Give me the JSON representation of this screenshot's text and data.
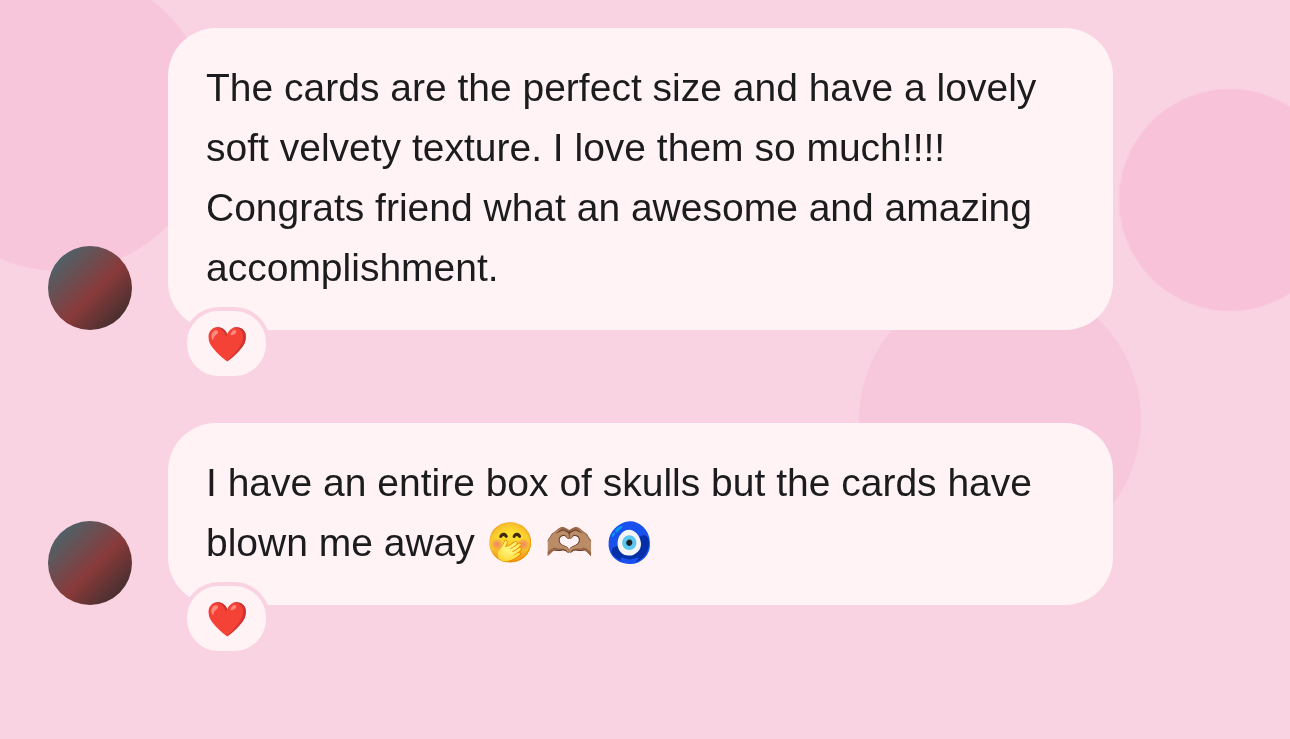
{
  "messages": [
    {
      "text": "The cards are the perfect size and have a lovely soft velvety texture. I love them so much!!!! Congrats friend what an awesome and amazing accomplishment.",
      "reaction": "❤️"
    },
    {
      "text": "I have an entire box of skulls but the cards have blown me away 🤭 🫶🏽 🧿",
      "reaction": "❤️"
    }
  ]
}
